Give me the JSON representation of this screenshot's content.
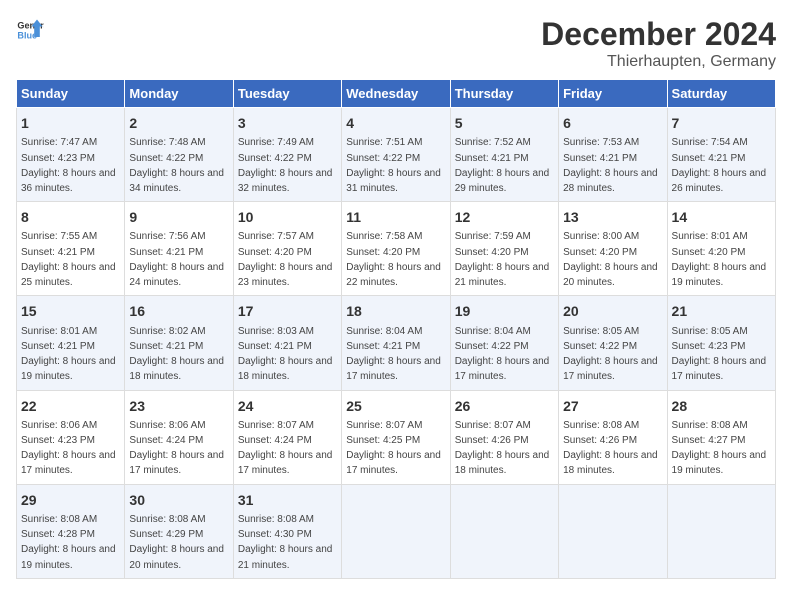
{
  "logo": {
    "general": "General",
    "blue": "Blue"
  },
  "title": "December 2024",
  "subtitle": "Thierhaupten, Germany",
  "headers": [
    "Sunday",
    "Monday",
    "Tuesday",
    "Wednesday",
    "Thursday",
    "Friday",
    "Saturday"
  ],
  "weeks": [
    [
      {
        "day": "1",
        "sunrise": "Sunrise: 7:47 AM",
        "sunset": "Sunset: 4:23 PM",
        "daylight": "Daylight: 8 hours and 36 minutes."
      },
      {
        "day": "2",
        "sunrise": "Sunrise: 7:48 AM",
        "sunset": "Sunset: 4:22 PM",
        "daylight": "Daylight: 8 hours and 34 minutes."
      },
      {
        "day": "3",
        "sunrise": "Sunrise: 7:49 AM",
        "sunset": "Sunset: 4:22 PM",
        "daylight": "Daylight: 8 hours and 32 minutes."
      },
      {
        "day": "4",
        "sunrise": "Sunrise: 7:51 AM",
        "sunset": "Sunset: 4:22 PM",
        "daylight": "Daylight: 8 hours and 31 minutes."
      },
      {
        "day": "5",
        "sunrise": "Sunrise: 7:52 AM",
        "sunset": "Sunset: 4:21 PM",
        "daylight": "Daylight: 8 hours and 29 minutes."
      },
      {
        "day": "6",
        "sunrise": "Sunrise: 7:53 AM",
        "sunset": "Sunset: 4:21 PM",
        "daylight": "Daylight: 8 hours and 28 minutes."
      },
      {
        "day": "7",
        "sunrise": "Sunrise: 7:54 AM",
        "sunset": "Sunset: 4:21 PM",
        "daylight": "Daylight: 8 hours and 26 minutes."
      }
    ],
    [
      {
        "day": "8",
        "sunrise": "Sunrise: 7:55 AM",
        "sunset": "Sunset: 4:21 PM",
        "daylight": "Daylight: 8 hours and 25 minutes."
      },
      {
        "day": "9",
        "sunrise": "Sunrise: 7:56 AM",
        "sunset": "Sunset: 4:21 PM",
        "daylight": "Daylight: 8 hours and 24 minutes."
      },
      {
        "day": "10",
        "sunrise": "Sunrise: 7:57 AM",
        "sunset": "Sunset: 4:20 PM",
        "daylight": "Daylight: 8 hours and 23 minutes."
      },
      {
        "day": "11",
        "sunrise": "Sunrise: 7:58 AM",
        "sunset": "Sunset: 4:20 PM",
        "daylight": "Daylight: 8 hours and 22 minutes."
      },
      {
        "day": "12",
        "sunrise": "Sunrise: 7:59 AM",
        "sunset": "Sunset: 4:20 PM",
        "daylight": "Daylight: 8 hours and 21 minutes."
      },
      {
        "day": "13",
        "sunrise": "Sunrise: 8:00 AM",
        "sunset": "Sunset: 4:20 PM",
        "daylight": "Daylight: 8 hours and 20 minutes."
      },
      {
        "day": "14",
        "sunrise": "Sunrise: 8:01 AM",
        "sunset": "Sunset: 4:20 PM",
        "daylight": "Daylight: 8 hours and 19 minutes."
      }
    ],
    [
      {
        "day": "15",
        "sunrise": "Sunrise: 8:01 AM",
        "sunset": "Sunset: 4:21 PM",
        "daylight": "Daylight: 8 hours and 19 minutes."
      },
      {
        "day": "16",
        "sunrise": "Sunrise: 8:02 AM",
        "sunset": "Sunset: 4:21 PM",
        "daylight": "Daylight: 8 hours and 18 minutes."
      },
      {
        "day": "17",
        "sunrise": "Sunrise: 8:03 AM",
        "sunset": "Sunset: 4:21 PM",
        "daylight": "Daylight: 8 hours and 18 minutes."
      },
      {
        "day": "18",
        "sunrise": "Sunrise: 8:04 AM",
        "sunset": "Sunset: 4:21 PM",
        "daylight": "Daylight: 8 hours and 17 minutes."
      },
      {
        "day": "19",
        "sunrise": "Sunrise: 8:04 AM",
        "sunset": "Sunset: 4:22 PM",
        "daylight": "Daylight: 8 hours and 17 minutes."
      },
      {
        "day": "20",
        "sunrise": "Sunrise: 8:05 AM",
        "sunset": "Sunset: 4:22 PM",
        "daylight": "Daylight: 8 hours and 17 minutes."
      },
      {
        "day": "21",
        "sunrise": "Sunrise: 8:05 AM",
        "sunset": "Sunset: 4:23 PM",
        "daylight": "Daylight: 8 hours and 17 minutes."
      }
    ],
    [
      {
        "day": "22",
        "sunrise": "Sunrise: 8:06 AM",
        "sunset": "Sunset: 4:23 PM",
        "daylight": "Daylight: 8 hours and 17 minutes."
      },
      {
        "day": "23",
        "sunrise": "Sunrise: 8:06 AM",
        "sunset": "Sunset: 4:24 PM",
        "daylight": "Daylight: 8 hours and 17 minutes."
      },
      {
        "day": "24",
        "sunrise": "Sunrise: 8:07 AM",
        "sunset": "Sunset: 4:24 PM",
        "daylight": "Daylight: 8 hours and 17 minutes."
      },
      {
        "day": "25",
        "sunrise": "Sunrise: 8:07 AM",
        "sunset": "Sunset: 4:25 PM",
        "daylight": "Daylight: 8 hours and 17 minutes."
      },
      {
        "day": "26",
        "sunrise": "Sunrise: 8:07 AM",
        "sunset": "Sunset: 4:26 PM",
        "daylight": "Daylight: 8 hours and 18 minutes."
      },
      {
        "day": "27",
        "sunrise": "Sunrise: 8:08 AM",
        "sunset": "Sunset: 4:26 PM",
        "daylight": "Daylight: 8 hours and 18 minutes."
      },
      {
        "day": "28",
        "sunrise": "Sunrise: 8:08 AM",
        "sunset": "Sunset: 4:27 PM",
        "daylight": "Daylight: 8 hours and 19 minutes."
      }
    ],
    [
      {
        "day": "29",
        "sunrise": "Sunrise: 8:08 AM",
        "sunset": "Sunset: 4:28 PM",
        "daylight": "Daylight: 8 hours and 19 minutes."
      },
      {
        "day": "30",
        "sunrise": "Sunrise: 8:08 AM",
        "sunset": "Sunset: 4:29 PM",
        "daylight": "Daylight: 8 hours and 20 minutes."
      },
      {
        "day": "31",
        "sunrise": "Sunrise: 8:08 AM",
        "sunset": "Sunset: 4:30 PM",
        "daylight": "Daylight: 8 hours and 21 minutes."
      },
      {
        "day": "",
        "sunrise": "",
        "sunset": "",
        "daylight": ""
      },
      {
        "day": "",
        "sunrise": "",
        "sunset": "",
        "daylight": ""
      },
      {
        "day": "",
        "sunrise": "",
        "sunset": "",
        "daylight": ""
      },
      {
        "day": "",
        "sunrise": "",
        "sunset": "",
        "daylight": ""
      }
    ]
  ]
}
